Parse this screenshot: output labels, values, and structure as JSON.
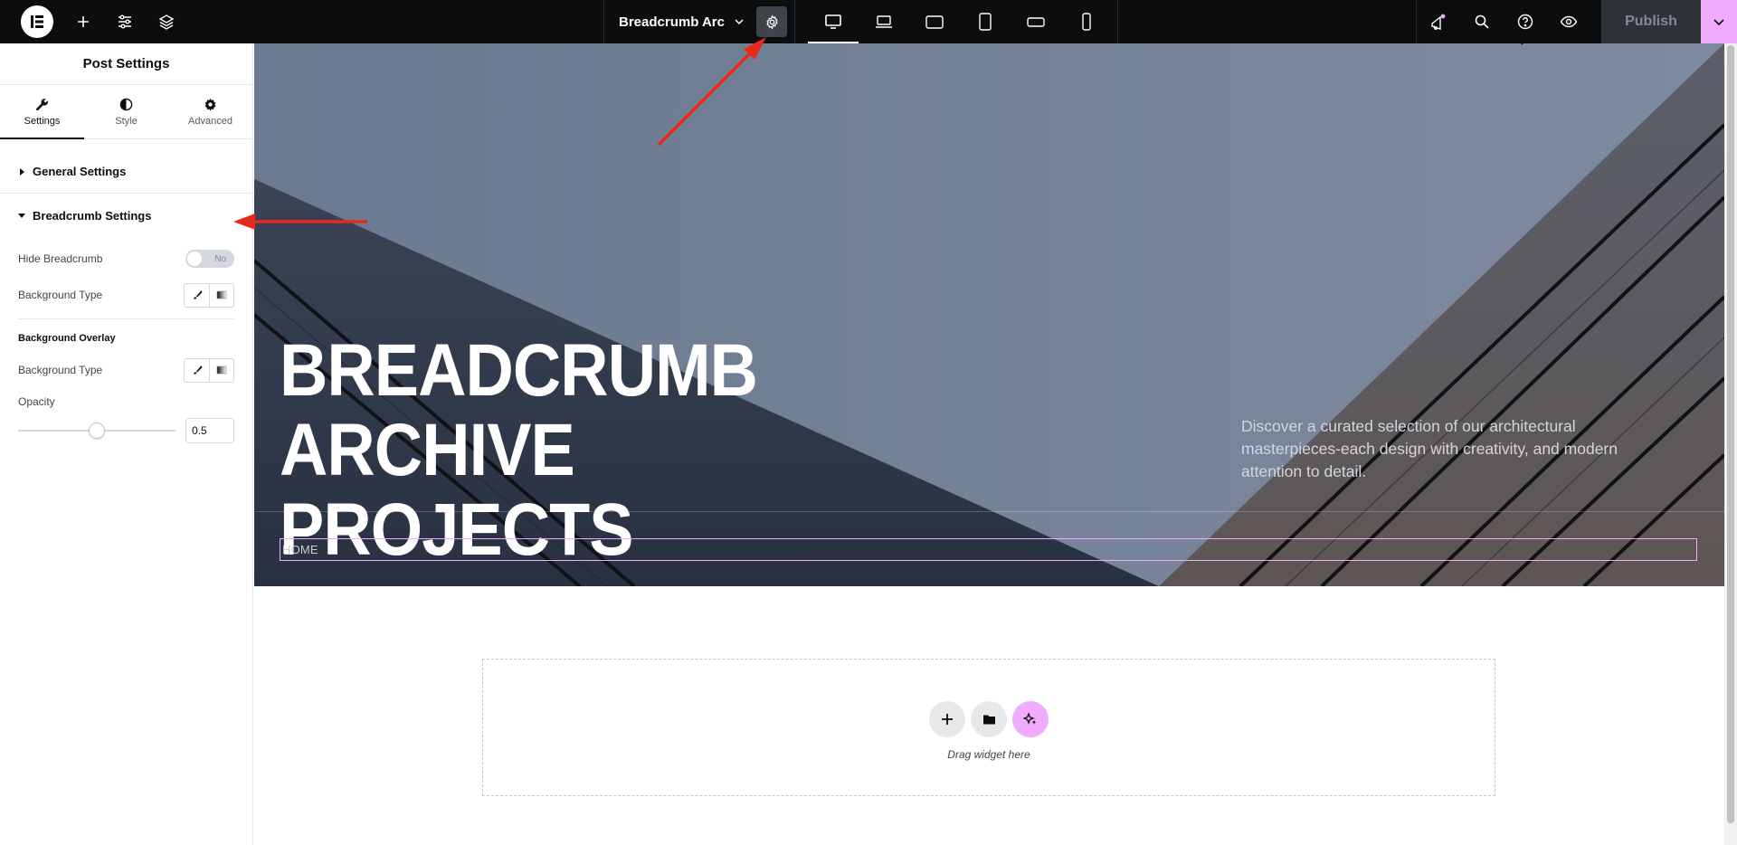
{
  "topbar": {
    "document_title": "Breadcrumb Arc...",
    "publish_label": "Publish",
    "icons": [
      "elementor-logo-icon",
      "add-icon",
      "site-settings-icon",
      "structure-layers-icon",
      "chevron-down-icon",
      "gear-icon",
      "desktop-icon",
      "laptop-icon",
      "tablet-landscape-icon",
      "tablet-portrait-icon",
      "mobile-landscape-icon",
      "mobile-portrait-icon",
      "whats-new-icon",
      "search-icon",
      "help-icon",
      "preview-eye-icon"
    ]
  },
  "panel": {
    "title": "Post Settings",
    "tabs": [
      {
        "label": "Settings",
        "icon": "wrench-icon",
        "active": true
      },
      {
        "label": "Style",
        "icon": "contrast-icon",
        "active": false
      },
      {
        "label": "Advanced",
        "icon": "gear-icon",
        "active": false
      }
    ],
    "general_settings_label": "General Settings",
    "breadcrumb_settings_label": "Breadcrumb Settings",
    "hide_breadcrumb_label": "Hide Breadcrumb",
    "hide_breadcrumb_value": "No",
    "background_type_label": "Background Type",
    "background_overlay_label": "Background Overlay",
    "overlay_background_type_label": "Background Type",
    "opacity_label": "Opacity",
    "opacity_value": "0.5"
  },
  "hero": {
    "title_line1": "BREADCRUMB ARCHIVE",
    "title_line2": "PROJECTS",
    "description": "Discover a curated selection of our architectural masterpieces-each design with creativity, and modern attention to detail.",
    "breadcrumb_text": "HOME"
  },
  "dropzone": {
    "label": "Drag widget here"
  },
  "colors": {
    "topbar_bg": "#0c0d0e",
    "accent_pink": "#f0abfc",
    "annotation_red": "#e8291c"
  }
}
